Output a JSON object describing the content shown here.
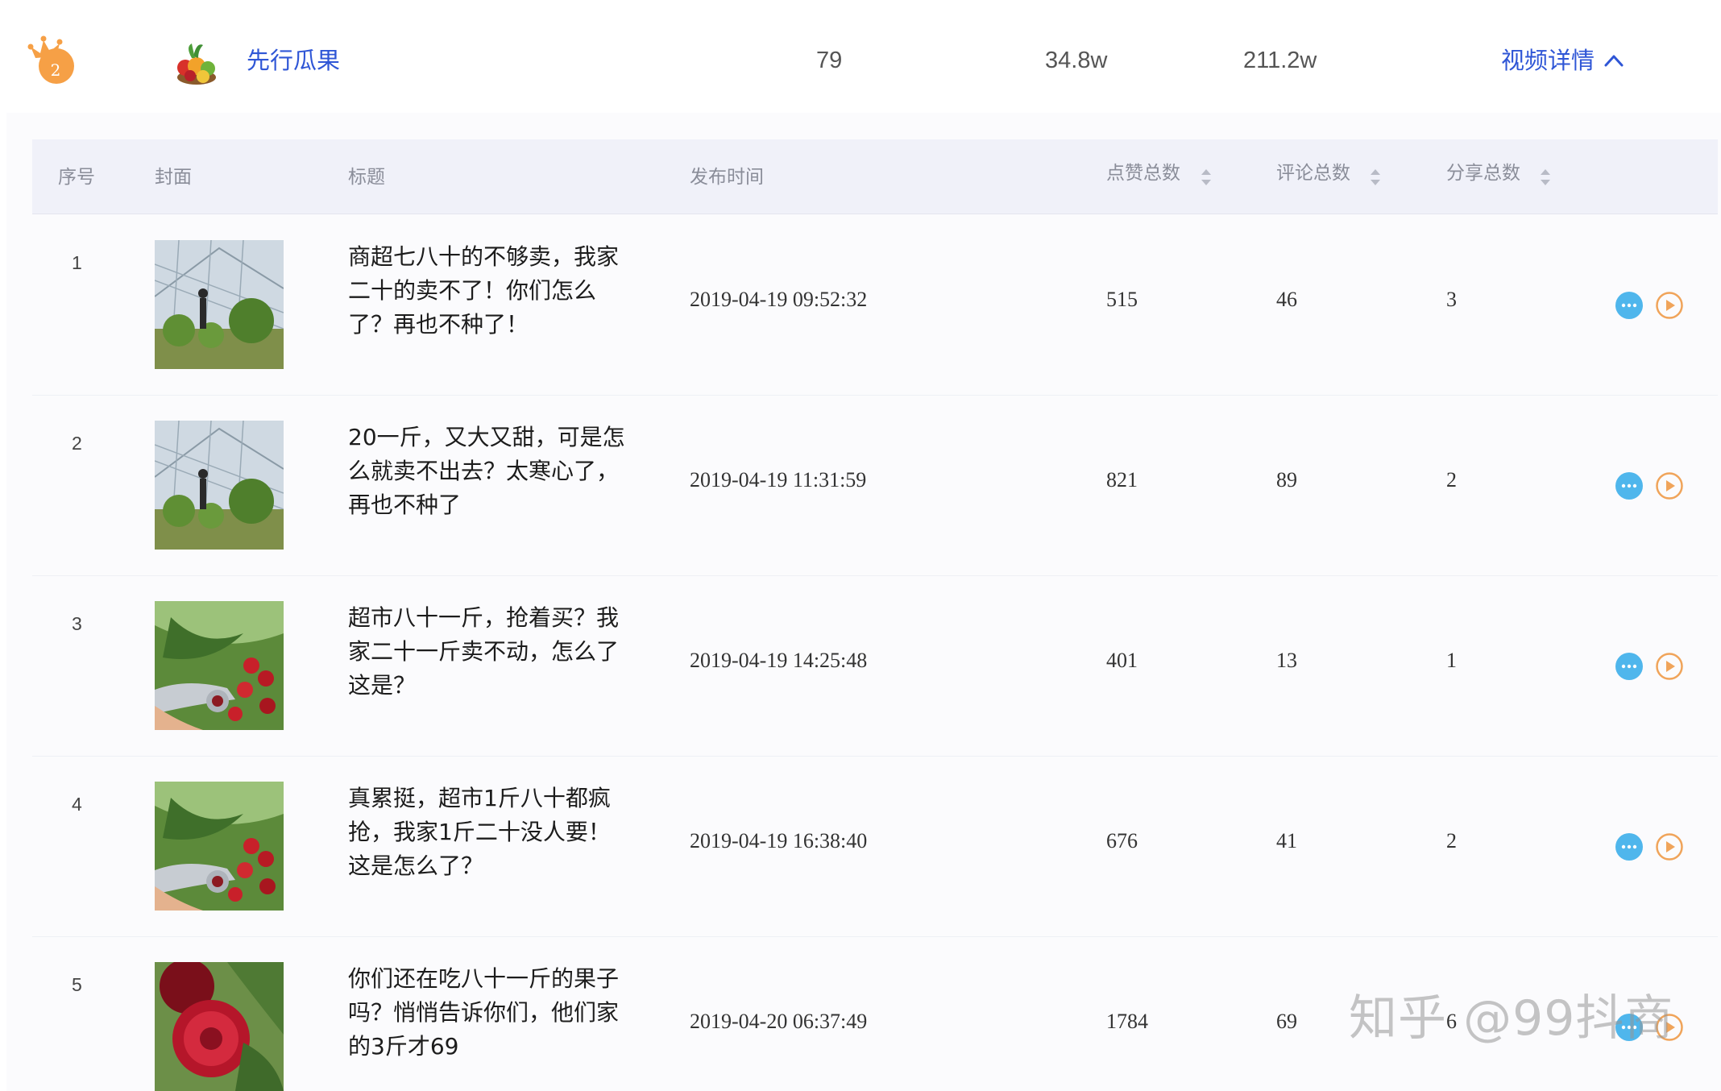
{
  "summary": {
    "rank": "2",
    "account_name": "先行瓜果",
    "video_count": "79",
    "likes_total": "34.8w",
    "fans_total": "211.2w",
    "detail_link": "视频详情",
    "detail_icon": "chevron-up-icon"
  },
  "table": {
    "headers": {
      "index": "序号",
      "cover": "封面",
      "title": "标题",
      "time": "发布时间",
      "likes": "点赞总数",
      "comments": "评论总数",
      "shares": "分享总数"
    },
    "rows": [
      {
        "index": "1",
        "cover": "greenhouse",
        "title": "商超七八十的不够卖，我家二十的卖不了！你们怎么了？再也不种了！",
        "time": "2019-04-19 09:52:32",
        "likes": "515",
        "comments": "46",
        "shares": "3"
      },
      {
        "index": "2",
        "cover": "greenhouse",
        "title": "20一斤，又大又甜，可是怎么就卖不出去？太寒心了，再也不种了",
        "time": "2019-04-19 11:31:59",
        "likes": "821",
        "comments": "89",
        "shares": "2"
      },
      {
        "index": "3",
        "cover": "cherry-pitter",
        "title": "超市八十一斤，抢着买？我家二十一斤卖不动，怎么了这是？",
        "time": "2019-04-19 14:25:48",
        "likes": "401",
        "comments": "13",
        "shares": "1"
      },
      {
        "index": "4",
        "cover": "cherry-pitter",
        "title": "真累挺，超市1斤八十都疯抢，我家1斤二十没人要！这是怎么了？",
        "time": "2019-04-19 16:38:40",
        "likes": "676",
        "comments": "41",
        "shares": "2"
      },
      {
        "index": "5",
        "cover": "cherry-cut",
        "title": "你们还在吃八十一斤的果子吗？悄悄告诉你们，他们家的3斤才69",
        "time": "2019-04-20 06:37:49",
        "likes": "1784",
        "comments": "69",
        "shares": "6"
      }
    ],
    "row_icons": [
      "comment-icon",
      "play-icon"
    ]
  },
  "watermark": "知乎 @99抖商",
  "colors": {
    "link_blue": "#2f56d6",
    "crown_orange": "#f6a046",
    "comment_blue": "#4fb6ec",
    "play_orange": "#f0a45a",
    "header_bg": "#f0f1f9"
  }
}
